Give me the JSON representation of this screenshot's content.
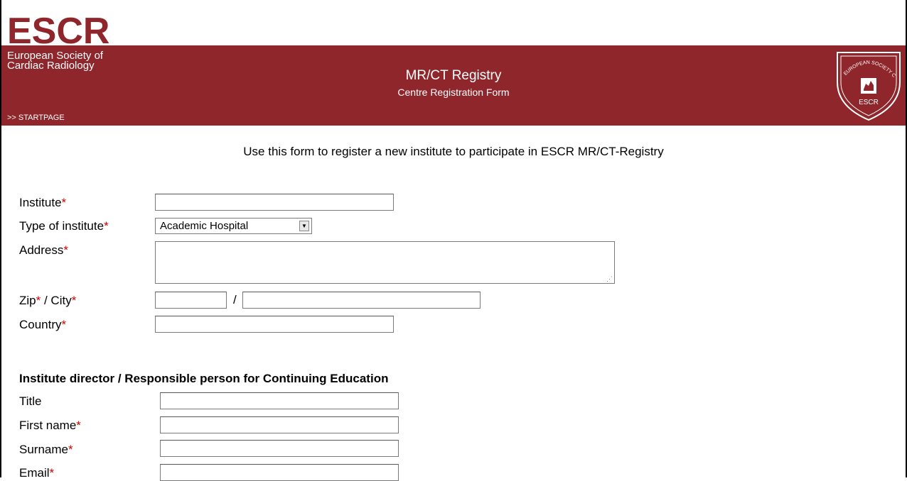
{
  "header": {
    "logo_text": "ESCR",
    "society_line1": "European Society of",
    "society_line2": "Cardiac Radiology",
    "startpage_link": ">> STARTPAGE",
    "title": "MR/CT Registry",
    "subtitle": "Centre Registration Form",
    "emblem_text": "ESCR",
    "emblem_ring": "EUROPEAN SOCIETY CARDIAC RADIOLOGY",
    "brand_color": "#8e262b"
  },
  "intro": "Use this form to register a new institute to participate in ESCR MR/CT-Registry",
  "required_marker": "*",
  "institute_form": {
    "institute_label": "Institute",
    "institute_value": "",
    "type_label": "Type of institute",
    "type_value": "Academic Hospital",
    "address_label": "Address",
    "address_value": "",
    "zip_label": "Zip",
    "city_label": " / City",
    "zip_separator": "/",
    "zip_value": "",
    "city_value": "",
    "country_label": "Country",
    "country_value": ""
  },
  "director_section": {
    "title": "Institute director / Responsible person for Continuing Education",
    "title_label": "Title",
    "first_name_label": "First name",
    "surname_label": "Surname",
    "email_label": "Email"
  },
  "icons": {
    "dropdown": "chevron-down-icon",
    "resize": "resize-grip-icon",
    "emblem": "escr-shield-emblem"
  }
}
